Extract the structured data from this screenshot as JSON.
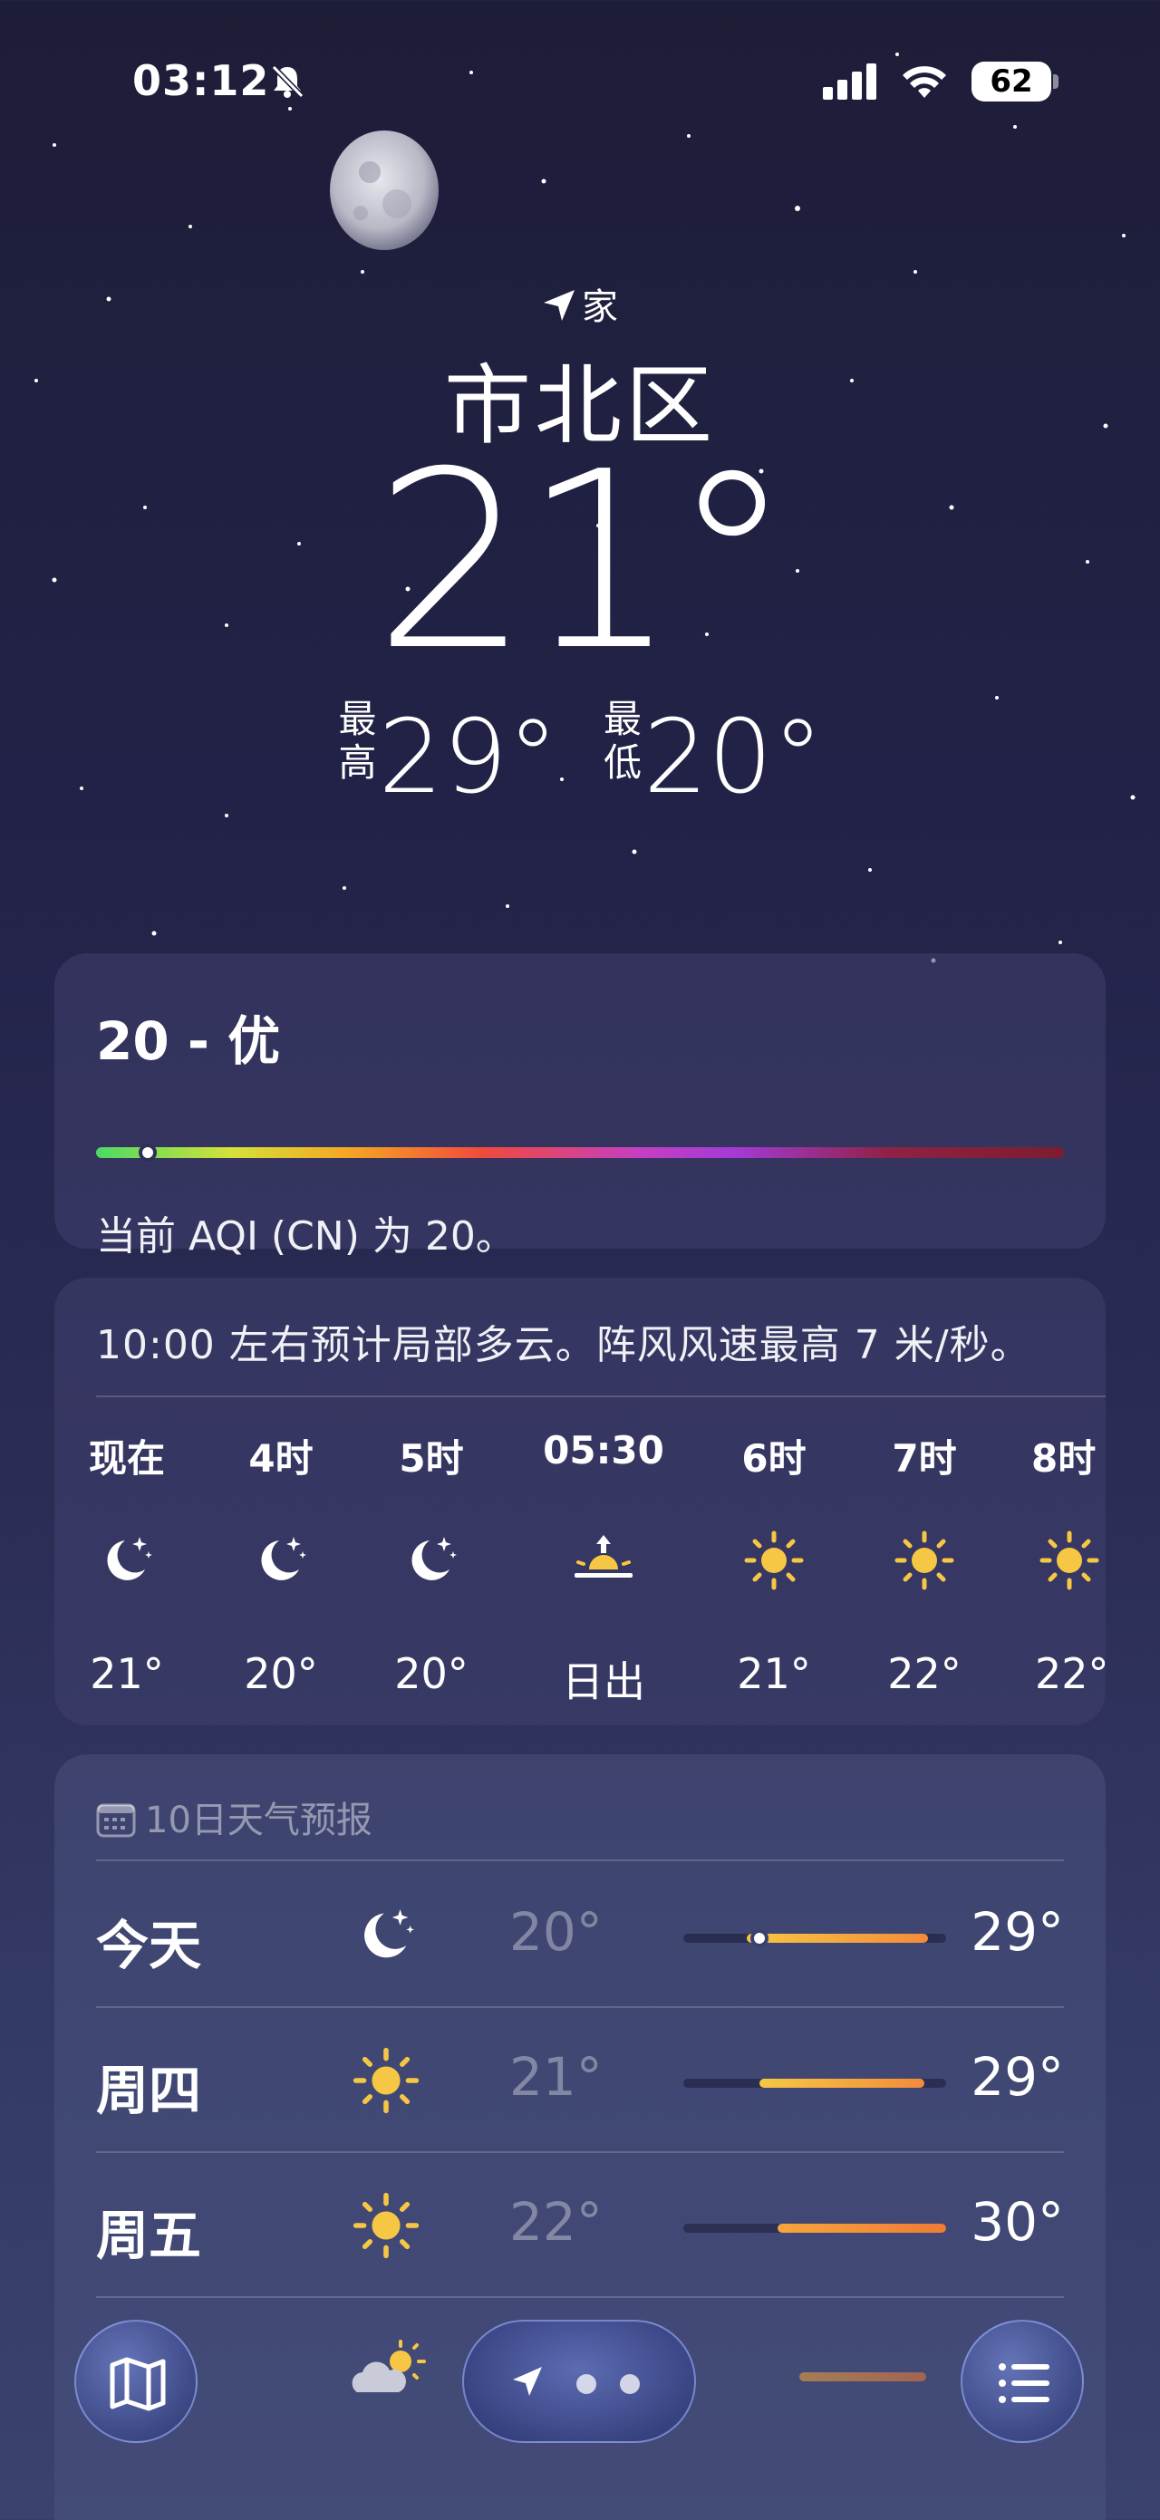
{
  "status_bar": {
    "time": "03:12",
    "battery": "62",
    "icons": [
      "bell-slash-icon",
      "cellular-signal-icon",
      "wifi-icon",
      "battery-icon"
    ]
  },
  "location": {
    "label": "家",
    "city": "市北区",
    "icon": "location-arrow-icon"
  },
  "current": {
    "temperature": "21°",
    "high_label": "最高",
    "high": "29°",
    "low_label": "最低",
    "low": "20°"
  },
  "aqi": {
    "title": "20 - 优",
    "description": "当前 AQI (CN) 为 20。",
    "value": 20
  },
  "hourly": {
    "note": "10:00 左右预计局部多云。阵风风速最高 7 米/秒。",
    "items": [
      {
        "label": "现在",
        "icon": "moon-stars-icon",
        "temp": "21°"
      },
      {
        "label": "4时",
        "icon": "moon-stars-icon",
        "temp": "20°"
      },
      {
        "label": "5时",
        "icon": "moon-stars-icon",
        "temp": "20°"
      },
      {
        "label": "05:30",
        "icon": "sunrise-icon",
        "temp": "日出"
      },
      {
        "label": "6时",
        "icon": "sun-icon",
        "temp": "21°"
      },
      {
        "label": "7时",
        "icon": "sun-icon",
        "temp": "22°"
      },
      {
        "label": "8时",
        "icon": "sun-icon",
        "temp": "22°"
      }
    ]
  },
  "forecast": {
    "title": "10日天气预报",
    "days": [
      {
        "day": "今天",
        "icon": "moon-stars-icon",
        "low": "20°",
        "high": "29°"
      },
      {
        "day": "周四",
        "icon": "sun-icon",
        "low": "21°",
        "high": "29°"
      },
      {
        "day": "周五",
        "icon": "sun-icon",
        "low": "22°",
        "high": "30°"
      }
    ]
  },
  "bottom_bar": {
    "map_icon": "map-icon",
    "list_icon": "list-icon",
    "pager_icon": "location-arrow-icon"
  }
}
